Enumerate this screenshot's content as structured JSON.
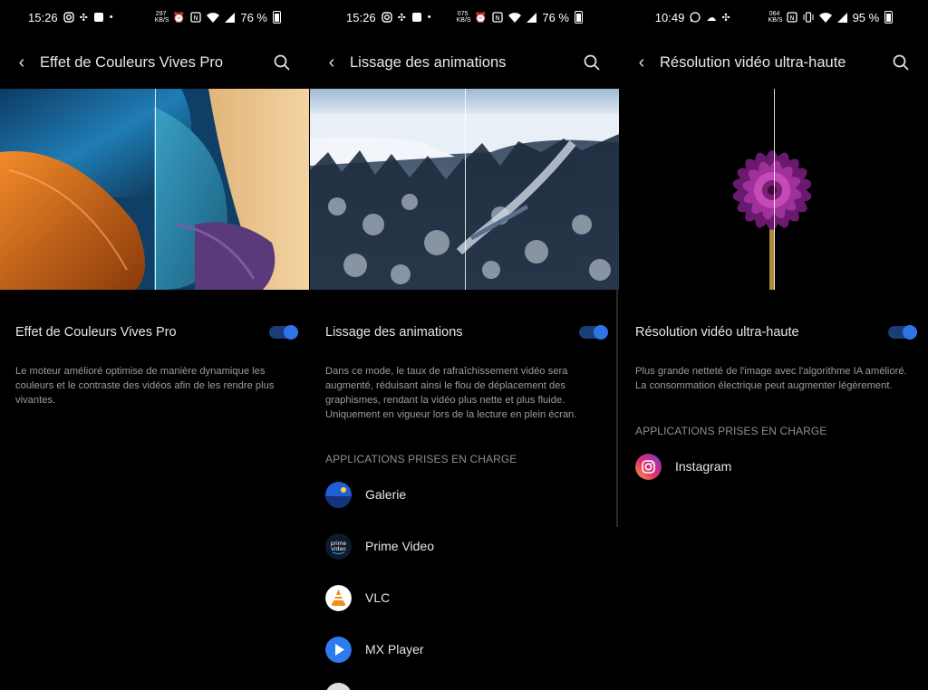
{
  "panels": [
    {
      "status": {
        "time": "15:26",
        "speed_top": "297",
        "speed_bottom": "KB/S",
        "battery": "76 %"
      },
      "title": "Effet de Couleurs Vives Pro",
      "setting_label": "Effet de Couleurs Vives Pro",
      "toggle_on": true,
      "description": "Le moteur amélioré optimise de manière dynamique les couleurs et le contraste des vidéos afin de les rendre plus vivantes."
    },
    {
      "status": {
        "time": "15:26",
        "speed_top": "075",
        "speed_bottom": "KB/S",
        "battery": "76 %"
      },
      "title": "Lissage des animations",
      "setting_label": "Lissage des animations",
      "toggle_on": true,
      "description": "Dans ce mode, le taux de rafraîchissement vidéo sera augmenté, réduisant ainsi le flou de déplacement des graphismes, rendant la vidéo plus nette et plus fluide. Uniquement en vigueur lors de la lecture en plein écran.",
      "section_header": "APPLICATIONS PRISES EN CHARGE",
      "apps": [
        {
          "name": "Galerie",
          "icon": "gallery-icon"
        },
        {
          "name": "Prime Video",
          "icon": "prime-video-icon"
        },
        {
          "name": "VLC",
          "icon": "vlc-icon"
        },
        {
          "name": "MX Player",
          "icon": "mx-player-icon"
        }
      ]
    },
    {
      "status": {
        "time": "10:49",
        "speed_top": "064",
        "speed_bottom": "KB/S",
        "battery": "95 %"
      },
      "title": "Résolution vidéo ultra-haute",
      "setting_label": "Résolution vidéo ultra-haute",
      "toggle_on": true,
      "description": "Plus grande netteté de l'image avec l'algorithme IA amélioré. La consommation électrique peut augmenter légèrement.",
      "section_header": "APPLICATIONS PRISES EN CHARGE",
      "apps": [
        {
          "name": "Instagram",
          "icon": "instagram-icon"
        }
      ]
    }
  ],
  "colors": {
    "accent": "#2f74e6",
    "toggle_track": "#1a3d7a",
    "background": "#000000"
  }
}
